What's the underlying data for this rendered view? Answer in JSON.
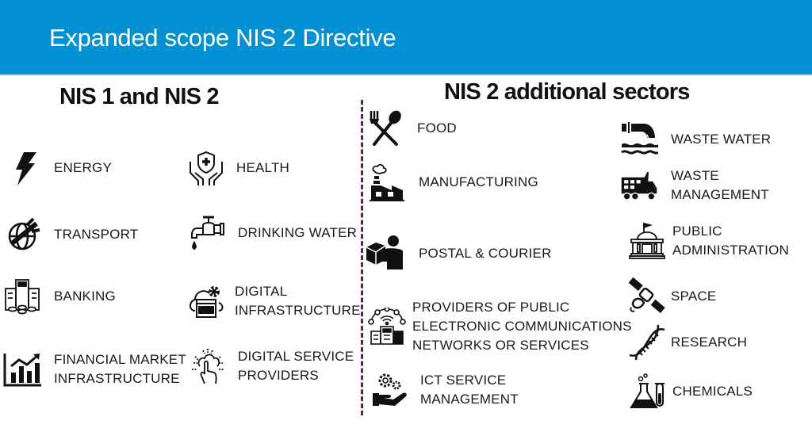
{
  "header": {
    "title": "Expanded scope NIS 2 Directive"
  },
  "columns": {
    "left_title": "NIS 1 and NIS 2",
    "right_title": "NIS 2 additional sectors"
  },
  "nis1_and_nis2": [
    {
      "label": "ENERGY",
      "icon": "lightning-bolt-icon"
    },
    {
      "label": "TRANSPORT",
      "icon": "globe-airplane-icon"
    },
    {
      "label": "BANKING",
      "icon": "bank-building-coins-icon"
    },
    {
      "label": "FINANCIAL MARKET\nINFRASTRUCTURE",
      "icon": "bar-chart-trend-icon"
    },
    {
      "label": "HEALTH",
      "icon": "hands-shield-cross-icon"
    },
    {
      "label": "DRINKING WATER",
      "icon": "water-tap-icon"
    },
    {
      "label": "DIGITAL\nINFRASTRUCTURE",
      "icon": "cloud-gear-window-icon"
    },
    {
      "label": "DIGITAL SERVICE\nPROVIDERS",
      "icon": "hand-touch-cloud-icon"
    }
  ],
  "nis2_additional": [
    {
      "label": "FOOD",
      "icon": "fork-spoon-icon"
    },
    {
      "label": "MANUFACTURING",
      "icon": "factory-icon"
    },
    {
      "label": "POSTAL & COURIER",
      "icon": "courier-package-icon"
    },
    {
      "label": "PROVIDERS OF PUBLIC\nELECTRONIC COMMUNICATIONS\nNETWORKS OR SERVICES",
      "icon": "network-building-wifi-icon"
    },
    {
      "label": "ICT SERVICE\nMANAGEMENT",
      "icon": "hand-gears-icon"
    },
    {
      "label": "WASTE WATER",
      "icon": "drain-pipe-icon"
    },
    {
      "label": "WASTE\nMANAGEMENT",
      "icon": "dump-truck-icon"
    },
    {
      "label": "PUBLIC\nADMINISTRATION",
      "icon": "government-building-icon"
    },
    {
      "label": "SPACE",
      "icon": "satellite-icon"
    },
    {
      "label": "RESEARCH",
      "icon": "dna-icon"
    },
    {
      "label": "CHEMICALS",
      "icon": "flask-tube-icon"
    }
  ],
  "colors": {
    "header_bg": "#0391d4",
    "divider": "#6b1a55"
  }
}
